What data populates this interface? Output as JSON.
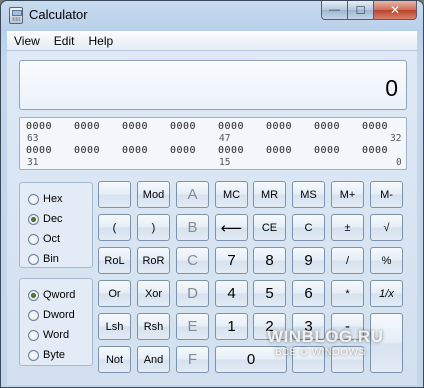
{
  "window": {
    "title": "Calculator",
    "controls": {
      "minimize": "—",
      "maximize": "☐",
      "close": "✕"
    }
  },
  "menu": [
    "View",
    "Edit",
    "Help"
  ],
  "display": {
    "value": "0"
  },
  "bits": {
    "groups": [
      "0000",
      "0000",
      "0000",
      "0000",
      "0000",
      "0000",
      "0000",
      "0000",
      "0000",
      "0000",
      "0000",
      "0000",
      "0000",
      "0000",
      "0000",
      "0000"
    ],
    "indices": [
      "63",
      "47",
      "32",
      "31",
      "15",
      "0"
    ]
  },
  "base_modes": [
    {
      "label": "Hex",
      "selected": false
    },
    {
      "label": "Dec",
      "selected": true
    },
    {
      "label": "Oct",
      "selected": false
    },
    {
      "label": "Bin",
      "selected": false
    }
  ],
  "word_sizes": [
    {
      "label": "Qword",
      "selected": true
    },
    {
      "label": "Dword",
      "selected": false
    },
    {
      "label": "Word",
      "selected": false
    },
    {
      "label": "Byte",
      "selected": false
    }
  ],
  "keys": {
    "blank": "",
    "mod": "Mod",
    "A": "A",
    "MC": "MC",
    "MR": "MR",
    "MS": "MS",
    "Mplus": "M+",
    "Mminus": "M-",
    "lparen": "(",
    "rparen": ")",
    "B": "B",
    "back": "⟵",
    "CE": "CE",
    "C": "C",
    "plusminus": "±",
    "sqrt": "√",
    "RoL": "RoL",
    "RoR": "RoR",
    "Ckey": "C",
    "n7": "7",
    "n8": "8",
    "n9": "9",
    "div": "/",
    "pct": "%",
    "Or": "Or",
    "Xor": "Xor",
    "D": "D",
    "n4": "4",
    "n5": "5",
    "n6": "6",
    "mul": "*",
    "recip": "1/x",
    "Lsh": "Lsh",
    "Rsh": "Rsh",
    "E": "E",
    "n1": "1",
    "n2": "2",
    "n3": "3",
    "sub": "-",
    "Not": "Not",
    "And": "And",
    "F": "F",
    "n0": "0"
  },
  "watermark": {
    "line1": "WINBLOG.RU",
    "line2": "ВСЁ О WINDOWS"
  }
}
